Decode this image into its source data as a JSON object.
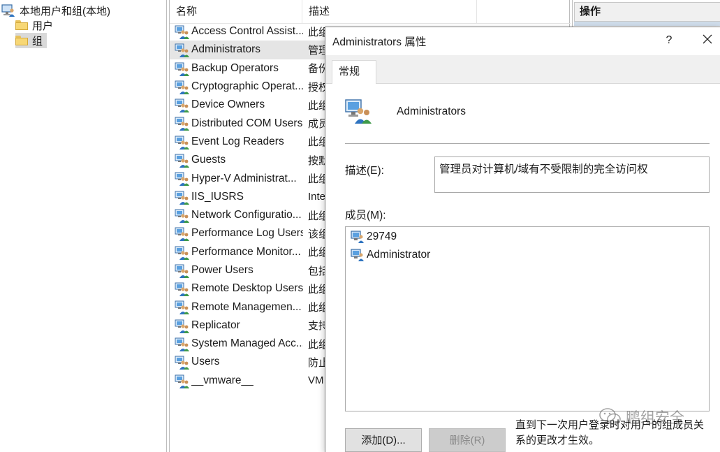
{
  "tree": {
    "root_label": "本地用户和组(本地)",
    "items": [
      {
        "label": "用户",
        "icon": "folder-icon"
      },
      {
        "label": "组",
        "icon": "folder-icon"
      }
    ]
  },
  "list": {
    "columns": [
      "名称",
      "描述"
    ],
    "rows": [
      {
        "name": "Access Control Assist...",
        "desc": "此组"
      },
      {
        "name": "Administrators",
        "desc": "管理"
      },
      {
        "name": "Backup Operators",
        "desc": "备份"
      },
      {
        "name": "Cryptographic Operat...",
        "desc": "授权"
      },
      {
        "name": "Device Owners",
        "desc": "此组"
      },
      {
        "name": "Distributed COM Users",
        "desc": "成员"
      },
      {
        "name": "Event Log Readers",
        "desc": "此组"
      },
      {
        "name": "Guests",
        "desc": "按默"
      },
      {
        "name": "Hyper-V Administrat...",
        "desc": "此组"
      },
      {
        "name": "IIS_IUSRS",
        "desc": "Inte"
      },
      {
        "name": "Network Configuratio...",
        "desc": "此组"
      },
      {
        "name": "Performance Log Users",
        "desc": "该组"
      },
      {
        "name": "Performance Monitor...",
        "desc": "此组"
      },
      {
        "name": "Power Users",
        "desc": "包括"
      },
      {
        "name": "Remote Desktop Users",
        "desc": "此组"
      },
      {
        "name": "Remote Managemen...",
        "desc": "此组"
      },
      {
        "name": "Replicator",
        "desc": "支持"
      },
      {
        "name": "System Managed Acc...",
        "desc": "此组"
      },
      {
        "name": "Users",
        "desc": "防止"
      },
      {
        "name": "__vmware__",
        "desc": "VM"
      }
    ],
    "selected_index": 1
  },
  "action_pane": {
    "header": "操作"
  },
  "dialog": {
    "title": "Administrators 属性",
    "help_label": "?",
    "tab": "常规",
    "group_name": "Administrators",
    "description_label": "描述(E):",
    "description_value": "管理员对计算机/域有不受限制的完全访问权",
    "members_label": "成员(M):",
    "members": [
      "29749",
      "Administrator"
    ],
    "add_button": "添加(D)...",
    "remove_button": "删除(R)",
    "note": "直到下一次用户登录时对用户的组成员关系的更改才生效。"
  },
  "watermark": "鹏组安全",
  "colors": {
    "selection": "#e5e5e5",
    "folder": "#f7d775",
    "accent_blue": "#2b6cc4"
  }
}
